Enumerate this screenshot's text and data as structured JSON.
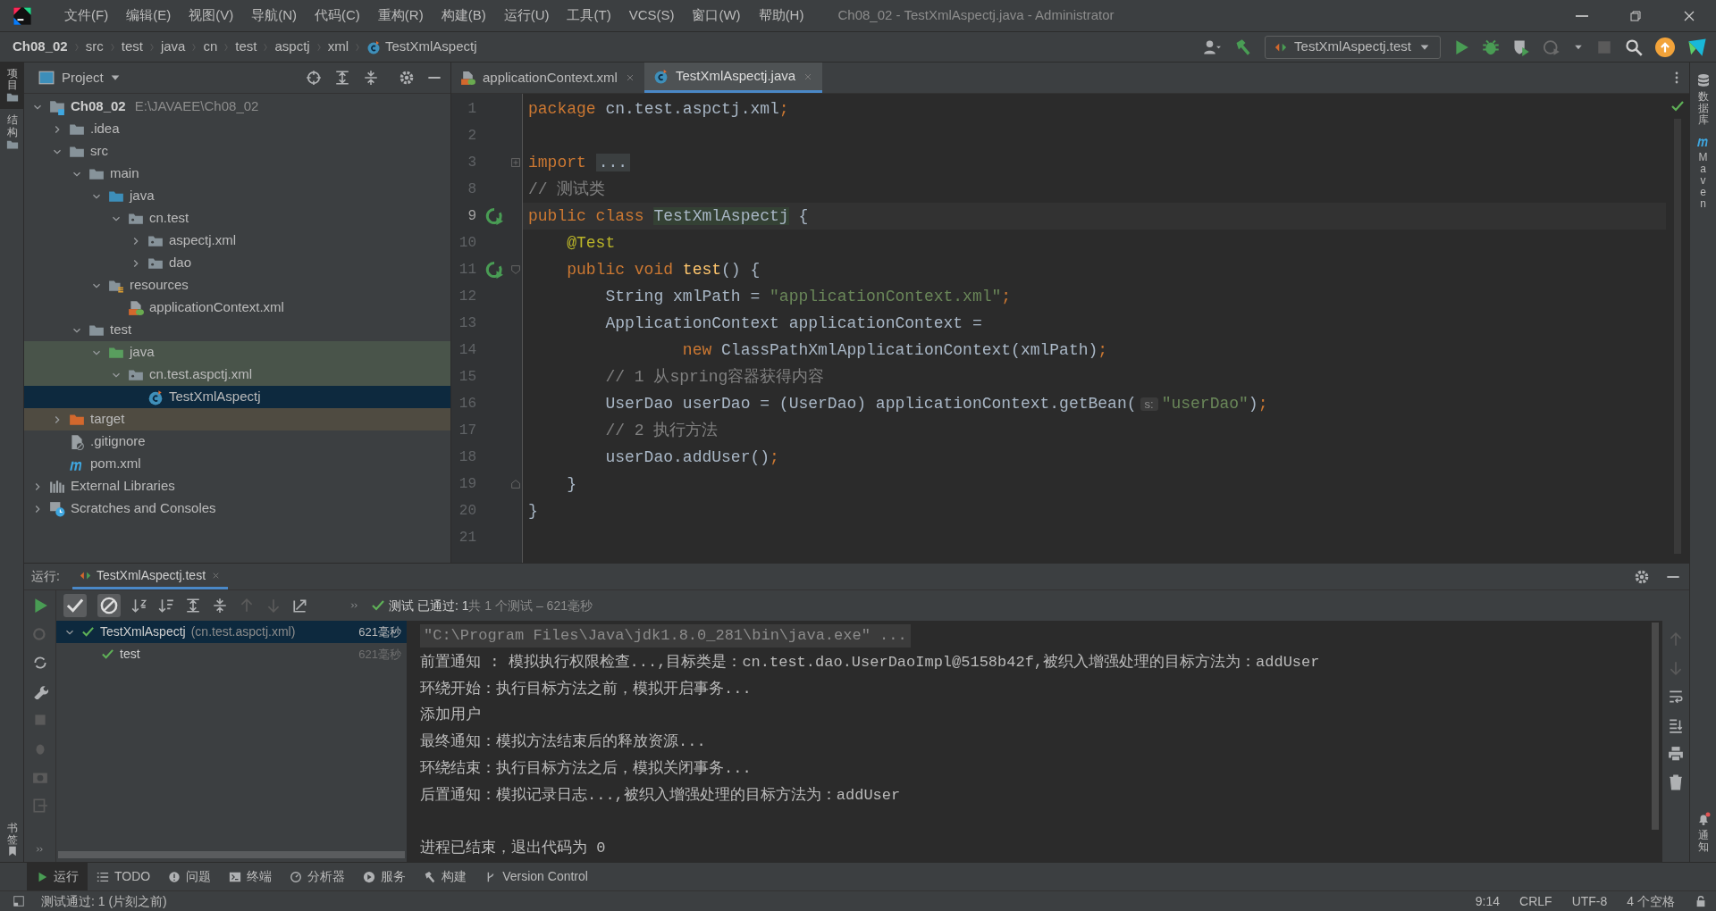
{
  "window": {
    "title": "Ch08_02 - TestXmlAspectj.java - Administrator"
  },
  "menu": [
    "文件(F)",
    "编辑(E)",
    "视图(V)",
    "导航(N)",
    "代码(C)",
    "重构(R)",
    "构建(B)",
    "运行(U)",
    "工具(T)",
    "VCS(S)",
    "窗口(W)",
    "帮助(H)"
  ],
  "breadcrumbs": [
    {
      "label": "Ch08_02",
      "kind": "project"
    },
    {
      "label": "src",
      "kind": "folder"
    },
    {
      "label": "test",
      "kind": "folder"
    },
    {
      "label": "java",
      "kind": "folder"
    },
    {
      "label": "cn",
      "kind": "folder"
    },
    {
      "label": "test",
      "kind": "folder"
    },
    {
      "label": "aspctj",
      "kind": "folder"
    },
    {
      "label": "xml",
      "kind": "folder"
    },
    {
      "label": "TestXmlAspectj",
      "kind": "class"
    }
  ],
  "run_config": {
    "label": "TestXmlAspectj.test"
  },
  "left_stripe": {
    "top": [
      {
        "label": "项目",
        "selected": true
      },
      {
        "label": "结构",
        "selected": false
      }
    ],
    "bottom": [
      {
        "label": "书签",
        "selected": false
      }
    ]
  },
  "right_stripe": {
    "top": [
      {
        "label": "数据库",
        "kind": "database"
      },
      {
        "label": "Maven",
        "kind": "maven"
      }
    ],
    "bottom": [
      {
        "label": "通知",
        "kind": "bell"
      }
    ]
  },
  "project_panel": {
    "title": "Project",
    "tree": [
      {
        "label": "Ch08_02",
        "path": "E:\\JAVAEE\\Ch08_02",
        "kind": "module",
        "expanded": true,
        "selected": false,
        "test_scope": false,
        "children": [
          {
            "label": ".idea",
            "kind": "folder",
            "expanded": false,
            "selected": false,
            "test_scope": false
          },
          {
            "label": "src",
            "kind": "folder",
            "expanded": true,
            "selected": false,
            "test_scope": false,
            "children": [
              {
                "label": "main",
                "kind": "folder",
                "expanded": true,
                "selected": false,
                "test_scope": false,
                "children": [
                  {
                    "label": "java",
                    "kind": "source",
                    "expanded": true,
                    "selected": false,
                    "test_scope": false,
                    "children": [
                      {
                        "label": "cn.test",
                        "kind": "package",
                        "expanded": true,
                        "selected": false,
                        "test_scope": false,
                        "children": [
                          {
                            "label": "aspectj.xml",
                            "kind": "package",
                            "expanded": false,
                            "selected": false,
                            "test_scope": false
                          },
                          {
                            "label": "dao",
                            "kind": "package",
                            "expanded": false,
                            "selected": false,
                            "test_scope": false
                          }
                        ]
                      }
                    ]
                  },
                  {
                    "label": "resources",
                    "kind": "resources",
                    "expanded": true,
                    "selected": false,
                    "test_scope": false,
                    "children": [
                      {
                        "label": "applicationContext.xml",
                        "kind": "xml",
                        "selected": false,
                        "test_scope": false
                      }
                    ]
                  }
                ]
              },
              {
                "label": "test",
                "kind": "folder",
                "expanded": true,
                "selected": false,
                "test_scope": false,
                "children": [
                  {
                    "label": "java",
                    "kind": "testsource",
                    "expanded": true,
                    "selected": false,
                    "test_scope": true,
                    "children": [
                      {
                        "label": "cn.test.aspctj.xml",
                        "kind": "package",
                        "expanded": true,
                        "selected": false,
                        "test_scope": true,
                        "children": [
                          {
                            "label": "TestXmlAspectj",
                            "kind": "class",
                            "selected": true
                          }
                        ]
                      }
                    ]
                  }
                ]
              }
            ]
          },
          {
            "label": "target",
            "kind": "excluded",
            "expanded": false,
            "selected": false
          },
          {
            "label": ".gitignore",
            "kind": "ignore",
            "selected": false,
            "test_scope": false
          },
          {
            "label": "pom.xml",
            "kind": "maven",
            "selected": false,
            "test_scope": false
          }
        ]
      },
      {
        "label": "External Libraries",
        "kind": "libraries",
        "expanded": false,
        "selected": false,
        "test_scope": false
      },
      {
        "label": "Scratches and Consoles",
        "kind": "scratches",
        "expanded": false,
        "selected": false,
        "test_scope": false
      }
    ]
  },
  "editor": {
    "tabs": [
      {
        "label": "applicationContext.xml",
        "kind": "xml",
        "selected": false
      },
      {
        "label": "TestXmlAspectj.java",
        "kind": "class",
        "selected": true
      }
    ],
    "lines": [
      {
        "number": "1",
        "current": false,
        "tokens": [
          {
            "kind": "keyword",
            "text": "package "
          },
          {
            "kind": "plain",
            "text": "cn.test.aspctj.xml"
          },
          {
            "kind": "keyword",
            "text": ";"
          }
        ]
      },
      {
        "number": "2",
        "current": false
      },
      {
        "number": "3",
        "current": false,
        "collapsed": true,
        "tokens": [
          {
            "kind": "keyword",
            "text": "import "
          },
          {
            "kind": "folded",
            "text": "..."
          }
        ]
      },
      {
        "number": "8",
        "current": false,
        "tokens": [
          {
            "kind": "comment",
            "text": "// 测试类"
          }
        ]
      },
      {
        "number": "9",
        "current": true,
        "run_marker": true,
        "tokens": [
          {
            "kind": "keyword",
            "text": "public class "
          },
          {
            "kind": "match",
            "text": "TestXmlAspectj"
          },
          {
            "kind": "plain",
            "text": " {"
          }
        ]
      },
      {
        "number": "10",
        "current": false,
        "tokens": [
          {
            "kind": "annotation",
            "text": "    @Test"
          }
        ]
      },
      {
        "number": "11",
        "current": false,
        "run_marker": true,
        "fold_start": true,
        "tokens": [
          {
            "kind": "keyword",
            "text": "    public void "
          },
          {
            "kind": "method",
            "text": "test"
          },
          {
            "kind": "plain",
            "text": "() {"
          }
        ]
      },
      {
        "number": "12",
        "current": false,
        "tokens": [
          {
            "kind": "plain",
            "text": "        String xmlPath = "
          },
          {
            "kind": "string",
            "text": "\"applicationContext.xml\""
          },
          {
            "kind": "keyword",
            "text": ";"
          }
        ]
      },
      {
        "number": "13",
        "current": false,
        "tokens": [
          {
            "kind": "plain",
            "text": "        ApplicationContext applicationContext ="
          }
        ]
      },
      {
        "number": "14",
        "current": false,
        "tokens": [
          {
            "kind": "keyword",
            "text": "                new "
          },
          {
            "kind": "plain",
            "text": "ClassPathXmlApplicationContext(xmlPath)"
          },
          {
            "kind": "keyword",
            "text": ";"
          }
        ]
      },
      {
        "number": "15",
        "current": false,
        "tokens": [
          {
            "kind": "comment",
            "text": "        // 1 从spring容器获得内容"
          }
        ]
      },
      {
        "number": "16",
        "current": false,
        "tokens": [
          {
            "kind": "plain",
            "text": "        UserDao userDao = (UserDao) applicationContext.getBean("
          },
          {
            "kind": "hint",
            "text": "s:"
          },
          {
            "kind": "string",
            "text": "\"userDao\""
          },
          {
            "kind": "plain",
            "text": ")"
          },
          {
            "kind": "keyword",
            "text": ";"
          }
        ]
      },
      {
        "number": "17",
        "current": false,
        "tokens": [
          {
            "kind": "comment",
            "text": "        // 2 执行方法"
          }
        ]
      },
      {
        "number": "18",
        "current": false,
        "tokens": [
          {
            "kind": "plain",
            "text": "        userDao.addUser()"
          },
          {
            "kind": "keyword",
            "text": ";"
          }
        ]
      },
      {
        "number": "19",
        "current": false,
        "fold_end": true,
        "tokens": [
          {
            "kind": "plain",
            "text": "    }"
          }
        ]
      },
      {
        "number": "20",
        "current": false,
        "tokens": [
          {
            "kind": "plain",
            "text": "}"
          }
        ]
      },
      {
        "number": "21",
        "current": false
      }
    ]
  },
  "run_panel": {
    "label": "运行:",
    "tab": "TestXmlAspectj.test",
    "summary": {
      "passed": "测试 已通过: 1",
      "detail": "共 1 个测试 – 621毫秒"
    },
    "tests": [
      {
        "label": "TestXmlAspectj",
        "detail": "(cn.test.aspctj.xml)",
        "time": "621毫秒",
        "selected": true,
        "expanded": true,
        "children": [
          {
            "label": "test",
            "time": "621毫秒",
            "selected": false
          }
        ]
      }
    ],
    "console": [
      {
        "kind": "command",
        "text": "\"C:\\Program Files\\Java\\jdk1.8.0_281\\bin\\java.exe\" ..."
      },
      {
        "kind": "output",
        "text": "前置通知 : 模拟执行权限检查...,目标类是：cn.test.dao.UserDaoImpl@5158b42f,被织入增强处理的目标方法为：addUser"
      },
      {
        "kind": "output",
        "text": "环绕开始：执行目标方法之前，模拟开启事务..."
      },
      {
        "kind": "output",
        "text": "添加用户"
      },
      {
        "kind": "output",
        "text": "最终通知：模拟方法结束后的释放资源..."
      },
      {
        "kind": "output",
        "text": "环绕结束：执行目标方法之后，模拟关闭事务..."
      },
      {
        "kind": "output",
        "text": "后置通知：模拟记录日志...,被织入增强处理的目标方法为：addUser"
      },
      {
        "kind": "blank"
      },
      {
        "kind": "output",
        "text": "进程已结束，退出代码为 0"
      }
    ]
  },
  "tool_tabs": [
    {
      "label": "运行",
      "kind": "run",
      "selected": true
    },
    {
      "label": "TODO",
      "kind": "list",
      "selected": false
    },
    {
      "label": "问题",
      "kind": "info",
      "selected": false
    },
    {
      "label": "终端",
      "kind": "terminal",
      "selected": false
    },
    {
      "label": "分析器",
      "kind": "profiler",
      "selected": false
    },
    {
      "label": "服务",
      "kind": "services",
      "selected": false
    },
    {
      "label": "构建",
      "kind": "hammer",
      "selected": false
    },
    {
      "label": "Version Control",
      "kind": "vcs",
      "selected": false
    }
  ],
  "status_bar": {
    "message": "测试通过: 1 (片刻之前)",
    "items": [
      "9:14",
      "CRLF",
      "UTF-8",
      "4 个空格"
    ]
  }
}
